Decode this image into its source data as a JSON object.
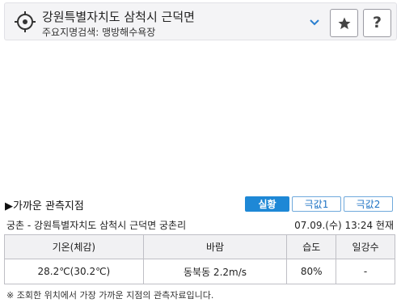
{
  "header": {
    "location_title": "강원특별자치도 삼척시 근덕면",
    "search_label": "주요지명검색: 맹방해수욕장",
    "help_label": "?"
  },
  "section": {
    "title": "▶가까운 관측지점",
    "tabs": [
      {
        "label": "실황",
        "active": true
      },
      {
        "label": "극값1",
        "active": false
      },
      {
        "label": "극값2",
        "active": false
      }
    ]
  },
  "station": {
    "name": "궁촌 - 강원특별자치도 삼척시 근덕면 궁촌리",
    "observed_at": "07.09.(수) 13:24 현재"
  },
  "table": {
    "headers": [
      "기온(체감)",
      "바람",
      "습도",
      "일강수"
    ],
    "row": [
      "28.2℃(30.2℃)",
      "동북동 2.2m/s",
      "80%",
      "-"
    ]
  },
  "footnote": "※ 조회한 위치에서 가장 가까운 지점의 관측자료입니다.",
  "colors": {
    "accent": "#1e88d6",
    "tab_border": "#6fa9dc",
    "header_bg": "#f4f4f6"
  },
  "icons": {
    "location": "crosshair-icon",
    "dropdown": "chevron-down-icon",
    "favorite": "star-icon",
    "help": "question-icon"
  }
}
